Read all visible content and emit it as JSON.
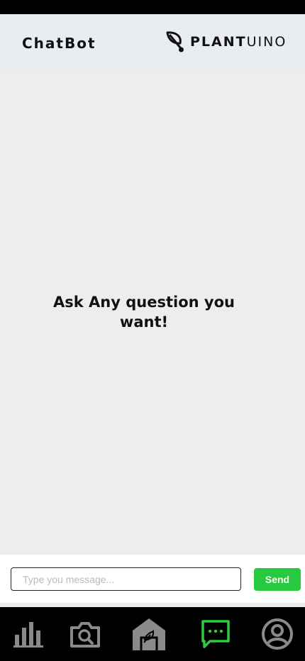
{
  "header": {
    "title": "ChatBot",
    "brand_bold": "PLANT",
    "brand_light": "UINO"
  },
  "chat": {
    "prompt": "Ask Any question you want!"
  },
  "composer": {
    "placeholder": "Type you message...",
    "send_label": "Send"
  },
  "nav": {
    "items": [
      {
        "icon": "bar-chart-icon",
        "active": false
      },
      {
        "icon": "camera-search-icon",
        "active": false
      },
      {
        "icon": "greenhouse-icon",
        "active": false
      },
      {
        "icon": "chat-icon",
        "active": true
      },
      {
        "icon": "account-icon",
        "active": false
      }
    ],
    "active_color": "#2ecc40",
    "inactive_color": "#8a8a8a"
  },
  "colors": {
    "send_button": "#27c93f",
    "header_bg": "#e9edf2",
    "page_bg": "#ededed"
  }
}
